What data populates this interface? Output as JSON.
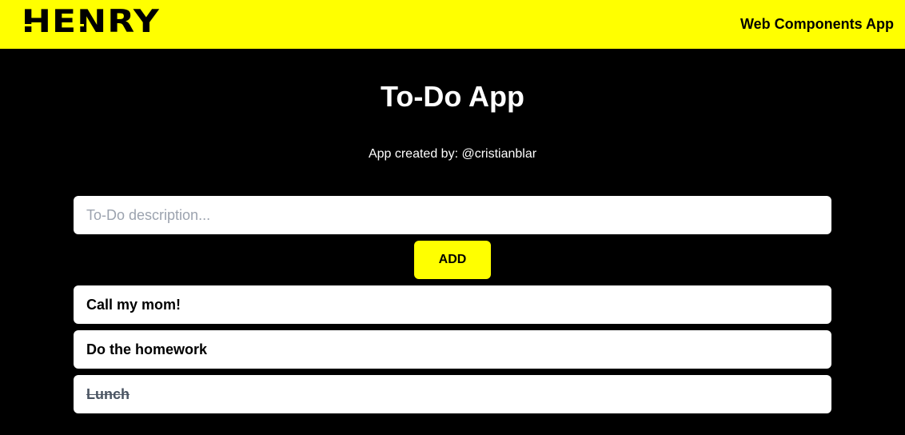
{
  "header": {
    "logo_text": "HENRY",
    "app_name": "Web Components App",
    "background_color": "#ffff00"
  },
  "main": {
    "title": "To-Do App",
    "credits": "App created by: @cristianblar",
    "input": {
      "placeholder": "To-Do description...",
      "value": ""
    },
    "add_button_label": "ADD",
    "todos": [
      {
        "text": "Call my mom!",
        "completed": false
      },
      {
        "text": "Do the homework",
        "completed": false
      },
      {
        "text": "Lunch",
        "completed": true
      }
    ]
  },
  "colors": {
    "accent": "#ffff00",
    "background": "#000000",
    "card": "#ffffff",
    "completed_text": "#4b5563"
  }
}
